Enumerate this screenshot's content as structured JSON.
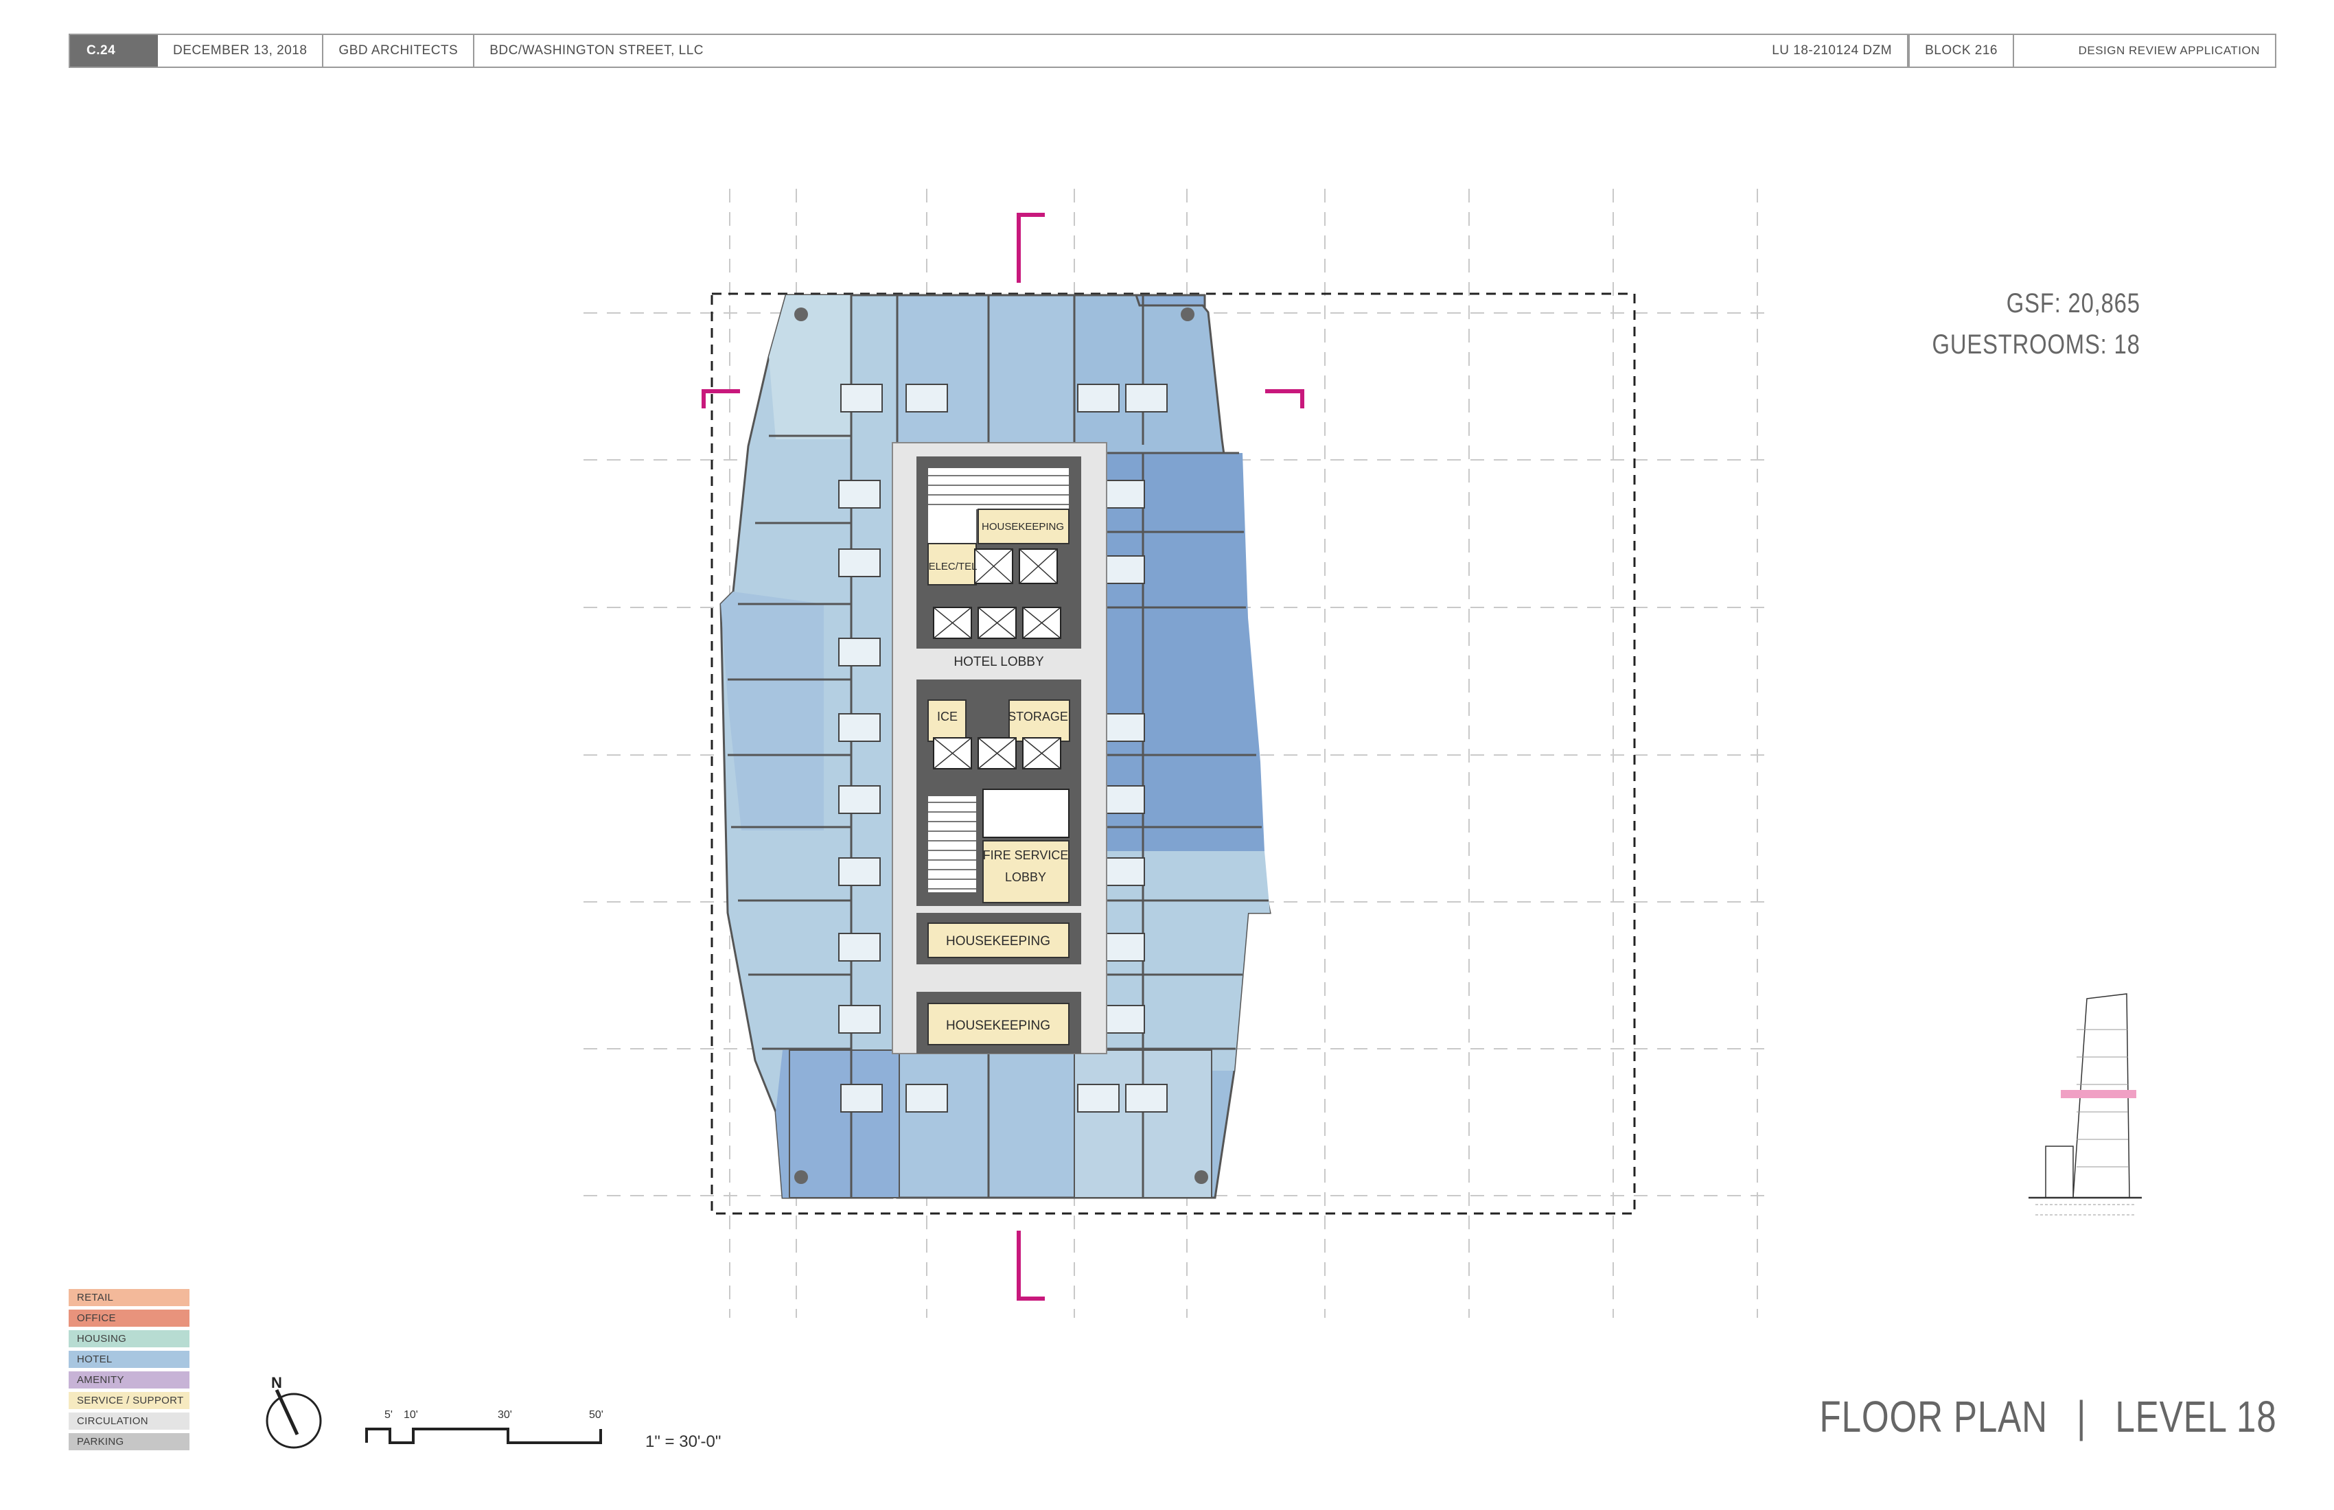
{
  "header": {
    "sheet": "C.24",
    "date": "DECEMBER 13,  2018",
    "architect": "GBD ARCHITECTS",
    "client": "BDC/WASHINGTON STREET, LLC",
    "case_no": "LU 18-210124 DZM",
    "block": "BLOCK 216",
    "phase": "DESIGN REVIEW APPLICATION"
  },
  "stats": {
    "gsf": "GSF:  20,865",
    "guestrooms": "GUESTROOMS:  18"
  },
  "rooms": {
    "housekeeping_top": "HOUSEKEEPING",
    "elec_tel": "ELEC/TEL",
    "hotel_lobby": "HOTEL LOBBY",
    "ice": "ICE",
    "storage": "STORAGE",
    "fire_service_lobby_1": "FIRE SERVICE",
    "fire_service_lobby_2": "LOBBY",
    "housekeeping_mid": "HOUSEKEEPING",
    "housekeeping_bottom": "HOUSEKEEPING"
  },
  "legend": [
    {
      "label": "RETAIL",
      "color": "#f3b99a"
    },
    {
      "label": "OFFICE",
      "color": "#e8937c"
    },
    {
      "label": "HOUSING",
      "color": "#b7dcd2"
    },
    {
      "label": "HOTEL",
      "color": "#a8c6e0"
    },
    {
      "label": "AMENITY",
      "color": "#c7b3d6"
    },
    {
      "label": "SERVICE / SUPPORT",
      "color": "#f6eac0"
    },
    {
      "label": "CIRCULATION",
      "color": "#e4e4e4"
    },
    {
      "label": "PARKING",
      "color": "#c6c6c6"
    }
  ],
  "north_label": "N",
  "scale_bar": {
    "ticks": [
      "5'",
      "10'",
      "30'",
      "50'"
    ],
    "ratio": "1\" = 30'-0\""
  },
  "title": {
    "main": "FLOOR PLAN",
    "separator": "|",
    "level": "LEVEL 18"
  },
  "colors": {
    "accent_magenta": "#c8187c",
    "hotel_light": "#b9d2e2",
    "hotel_mid": "#9ebedc",
    "hotel_dark": "#7fa3d0",
    "service": "#f6eac0",
    "core": "#5e5e5e",
    "corridor": "#e6e6e6"
  }
}
